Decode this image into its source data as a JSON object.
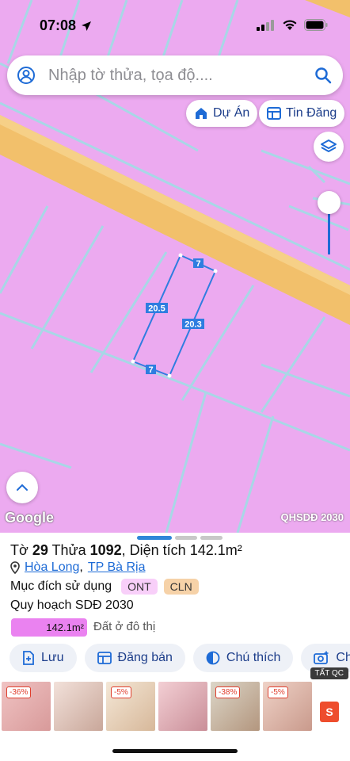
{
  "status": {
    "time": "07:08"
  },
  "search": {
    "placeholder": "Nhập tờ thửa, tọa độ...."
  },
  "chips": {
    "du_an": "Dự Án",
    "tin_dang": "Tin Đăng"
  },
  "map": {
    "dims": {
      "top": "7",
      "left": "20.5",
      "right": "20.3",
      "bottom": "7"
    },
    "google": "Google",
    "plan_label": "QHSDĐ 2030",
    "colors": {
      "land": "#ecaaf0",
      "road": "#f2c06b",
      "parcel_line": "#a8d7e6",
      "selection": "#2f7de0"
    }
  },
  "sheet": {
    "title_prefix_1": "Tờ ",
    "to": "29",
    "title_prefix_2": " Thửa ",
    "thua": "1092",
    "title_prefix_3": ", Diện tích ",
    "area": "142.1m²",
    "location_1": "Hòa Long",
    "location_sep": ",",
    "location_2": "TP Bà Rịa",
    "purpose_label": "Mục đích sử dụng",
    "purpose_tags": [
      "ONT",
      "CLN"
    ],
    "plan_heading": "Quy hoạch SDĐ 2030",
    "plan_bar_value": "142.1m²",
    "plan_bar_label": "Đất ở đô thị"
  },
  "actions": [
    "Lưu",
    "Đăng bán",
    "Chú thích",
    "Ch"
  ],
  "ads": {
    "tatqc": "TẤT QC",
    "discounts": [
      "-36%",
      "-5%",
      "-38%",
      "-5%"
    ],
    "shopee": "S"
  }
}
